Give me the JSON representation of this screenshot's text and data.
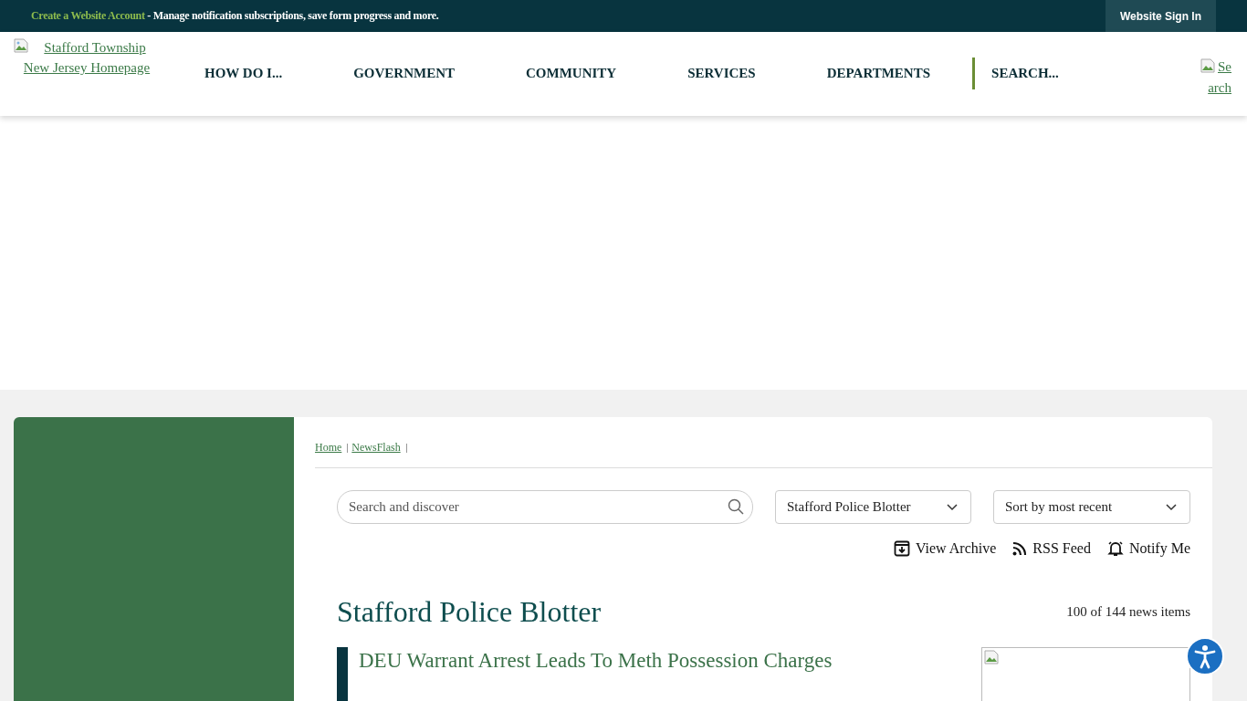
{
  "top_bar": {
    "account_link": "Create a Website Account",
    "account_text": " - Manage notification subscriptions, save form progress and more.",
    "sign_in": "Website Sign In"
  },
  "header": {
    "logo_alt": "Stafford Township New Jersey Homepage",
    "nav": [
      "HOW DO I...",
      "GOVERNMENT",
      "COMMUNITY",
      "SERVICES",
      "DEPARTMENTS"
    ],
    "search_placeholder": "SEARCH...",
    "search_alt": "Search"
  },
  "breadcrumbs": [
    "Home",
    "NewsFlash"
  ],
  "filters": {
    "search_placeholder": "Search and discover",
    "category": "Stafford Police Blotter",
    "sort": "Sort by most recent"
  },
  "actions": [
    {
      "kind": "archive",
      "label": "View Archive"
    },
    {
      "kind": "rss",
      "label": "RSS Feed"
    },
    {
      "kind": "notify",
      "label": "Notify Me"
    }
  ],
  "listing": {
    "title": "Stafford Police Blotter",
    "count": "100 of 144 news items",
    "items": [
      {
        "title": "DEU Warrant Arrest Leads To Meth Possession Charges"
      }
    ]
  }
}
